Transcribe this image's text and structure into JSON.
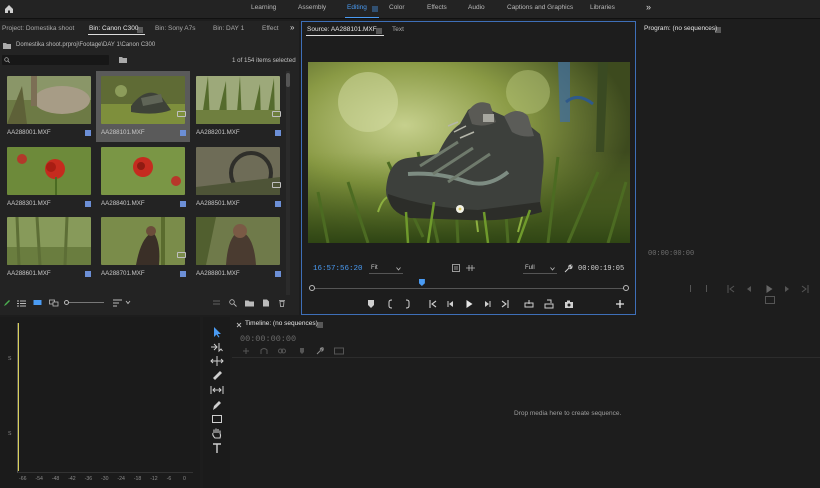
{
  "workspaces": {
    "items": [
      "Learning",
      "Assembly",
      "Editing",
      "Color",
      "Effects",
      "Audio",
      "Captions and Graphics",
      "Libraries"
    ],
    "active_index": 2,
    "overflow": "»"
  },
  "project_panel": {
    "tabs": [
      "Project: Domestika shoot",
      "Bin: Canon C300",
      "Bin: Sony A7s",
      "Bin: DAY 1",
      "Effect"
    ],
    "active_tab": 1,
    "path": "Domestika shoot.prproj\\Footage\\DAY 1\\Canon C300",
    "selection_count": "1 of 154 items selected",
    "search_placeholder": "",
    "clips": [
      "AA288001.MXF",
      "AA288101.MXF",
      "AA288201.MXF",
      "AA288301.MXF",
      "AA288401.MXF",
      "AA288501.MXF",
      "AA288601.MXF",
      "AA288701.MXF",
      "AA288801.MXF"
    ],
    "selected_clip_index": 1
  },
  "source_monitor": {
    "tabs": [
      "Source: AA288101.MXF",
      "Text"
    ],
    "timecode": "16:57:56:20",
    "fit": "Fit",
    "resolution": "Full",
    "duration": "00:00:19:05",
    "playhead_fraction": 0.35
  },
  "program_monitor": {
    "title": "Program: (no sequences)",
    "timecode": "00:00:00:00"
  },
  "timeline": {
    "title": "Timeline: (no sequences)",
    "timecode": "00:00:00:00",
    "empty_message": "Drop media here to create sequence."
  },
  "audio_meter": {
    "labels": [
      "-66",
      "-54",
      "-48",
      "-42",
      "-36",
      "-30",
      "-24",
      "-18",
      "-12",
      "-6",
      "0"
    ],
    "side_labels": [
      "S",
      "S"
    ]
  },
  "colors": {
    "accent": "#4a9bf3",
    "source_border": "#3e6fb8",
    "timecode": "#4a9bf3",
    "clip_badge": "#6c8fd6"
  }
}
